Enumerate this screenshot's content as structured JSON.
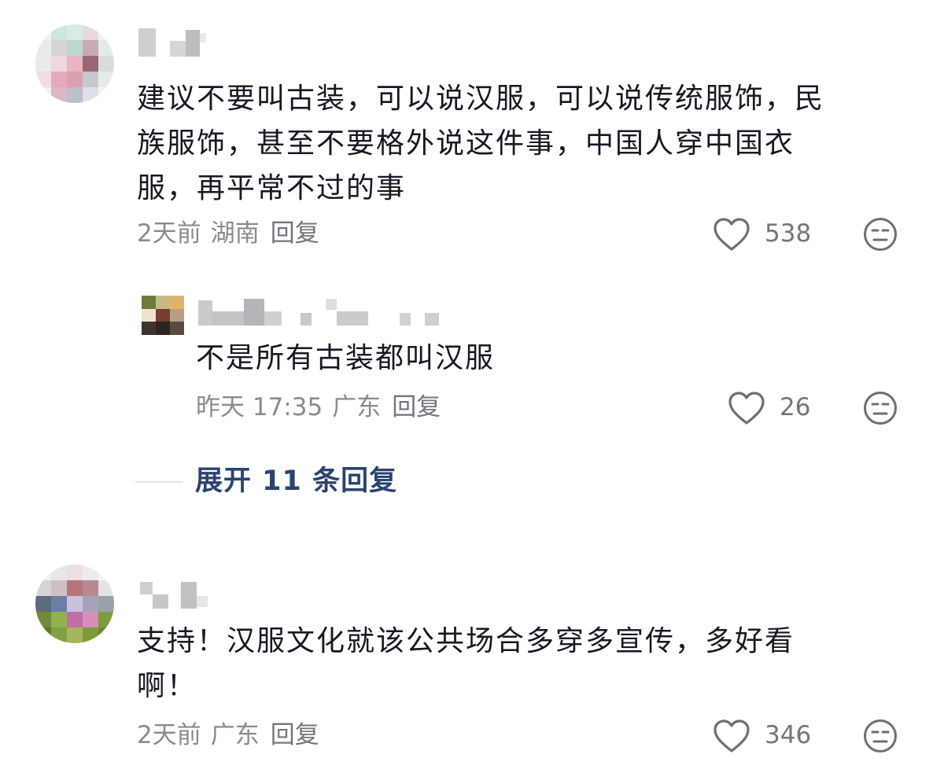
{
  "comments": [
    {
      "text": "建议不要叫古装，可以说汉服，可以说传统服饰，民\n族服饰，甚至不要格外说这件事，中国人穿中国衣\n服，再平常不过的事",
      "time": "2天前",
      "location": "湖南",
      "reply_label": "回复",
      "likes": "538",
      "reply": {
        "text": "不是所有古装都叫汉服",
        "time": "昨天 17:35",
        "location": "广东",
        "reply_label": "回复",
        "likes": "26"
      },
      "expand_label": "展开 11 条回复"
    },
    {
      "text": "支持！汉服文化就该公共场合多穿多宣传，多好看\n啊！",
      "time": "2天前",
      "location": "广东",
      "reply_label": "回复",
      "likes": "346"
    }
  ],
  "icons": {
    "like": "heart-outline-icon",
    "dislike": "dislike-face-icon"
  },
  "colors": {
    "text": "#161823",
    "meta": "#8a8b91",
    "link": "#2a4470",
    "icon": "#6e6f75"
  }
}
